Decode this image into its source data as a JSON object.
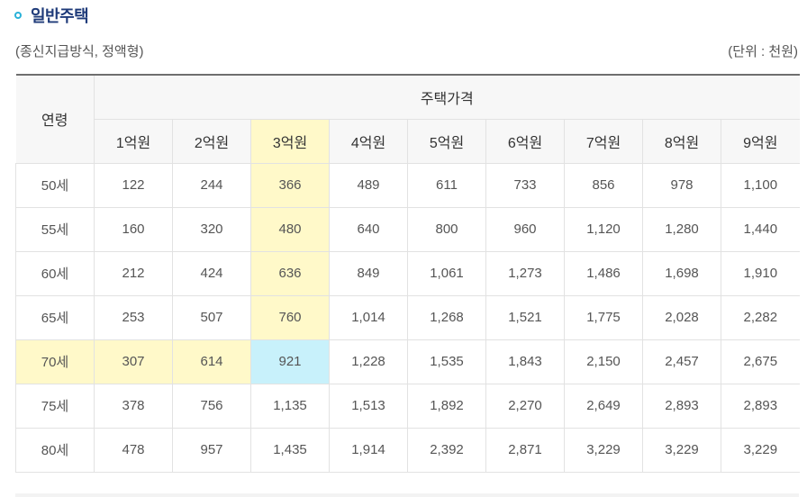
{
  "section": {
    "title": "일반주택",
    "subtitle": "(종신지급방식, 정액형)",
    "unit": "(단위 : 천원)"
  },
  "icons": {
    "title_bullet": "circle-bullet-icon"
  },
  "colors": {
    "title": "#1f3b7a",
    "bullet": "#2ab2d9",
    "highlight": "#fff9c9",
    "selected_cell": "#c8f1fb"
  },
  "table": {
    "age_header": "연령",
    "price_header": "주택가격",
    "prices": [
      "1억원",
      "2억원",
      "3억원",
      "4억원",
      "5억원",
      "6억원",
      "7억원",
      "8억원",
      "9억원"
    ],
    "highlighted_cell": {
      "row_index": 4,
      "col_index": 2
    },
    "rows": [
      {
        "age": "50세",
        "values": [
          "122",
          "244",
          "366",
          "489",
          "611",
          "733",
          "856",
          "978",
          "1,100"
        ]
      },
      {
        "age": "55세",
        "values": [
          "160",
          "320",
          "480",
          "640",
          "800",
          "960",
          "1,120",
          "1,280",
          "1,440"
        ]
      },
      {
        "age": "60세",
        "values": [
          "212",
          "424",
          "636",
          "849",
          "1,061",
          "1,273",
          "1,486",
          "1,698",
          "1,910"
        ]
      },
      {
        "age": "65세",
        "values": [
          "253",
          "507",
          "760",
          "1,014",
          "1,268",
          "1,521",
          "1,775",
          "2,028",
          "2,282"
        ]
      },
      {
        "age": "70세",
        "values": [
          "307",
          "614",
          "921",
          "1,228",
          "1,535",
          "1,843",
          "2,150",
          "2,457",
          "2,675"
        ]
      },
      {
        "age": "75세",
        "values": [
          "378",
          "756",
          "1,135",
          "1,513",
          "1,892",
          "2,270",
          "2,649",
          "2,893",
          "2,893"
        ]
      },
      {
        "age": "80세",
        "values": [
          "478",
          "957",
          "1,435",
          "1,914",
          "2,392",
          "2,871",
          "3,229",
          "3,229",
          "3,229"
        ]
      }
    ]
  }
}
